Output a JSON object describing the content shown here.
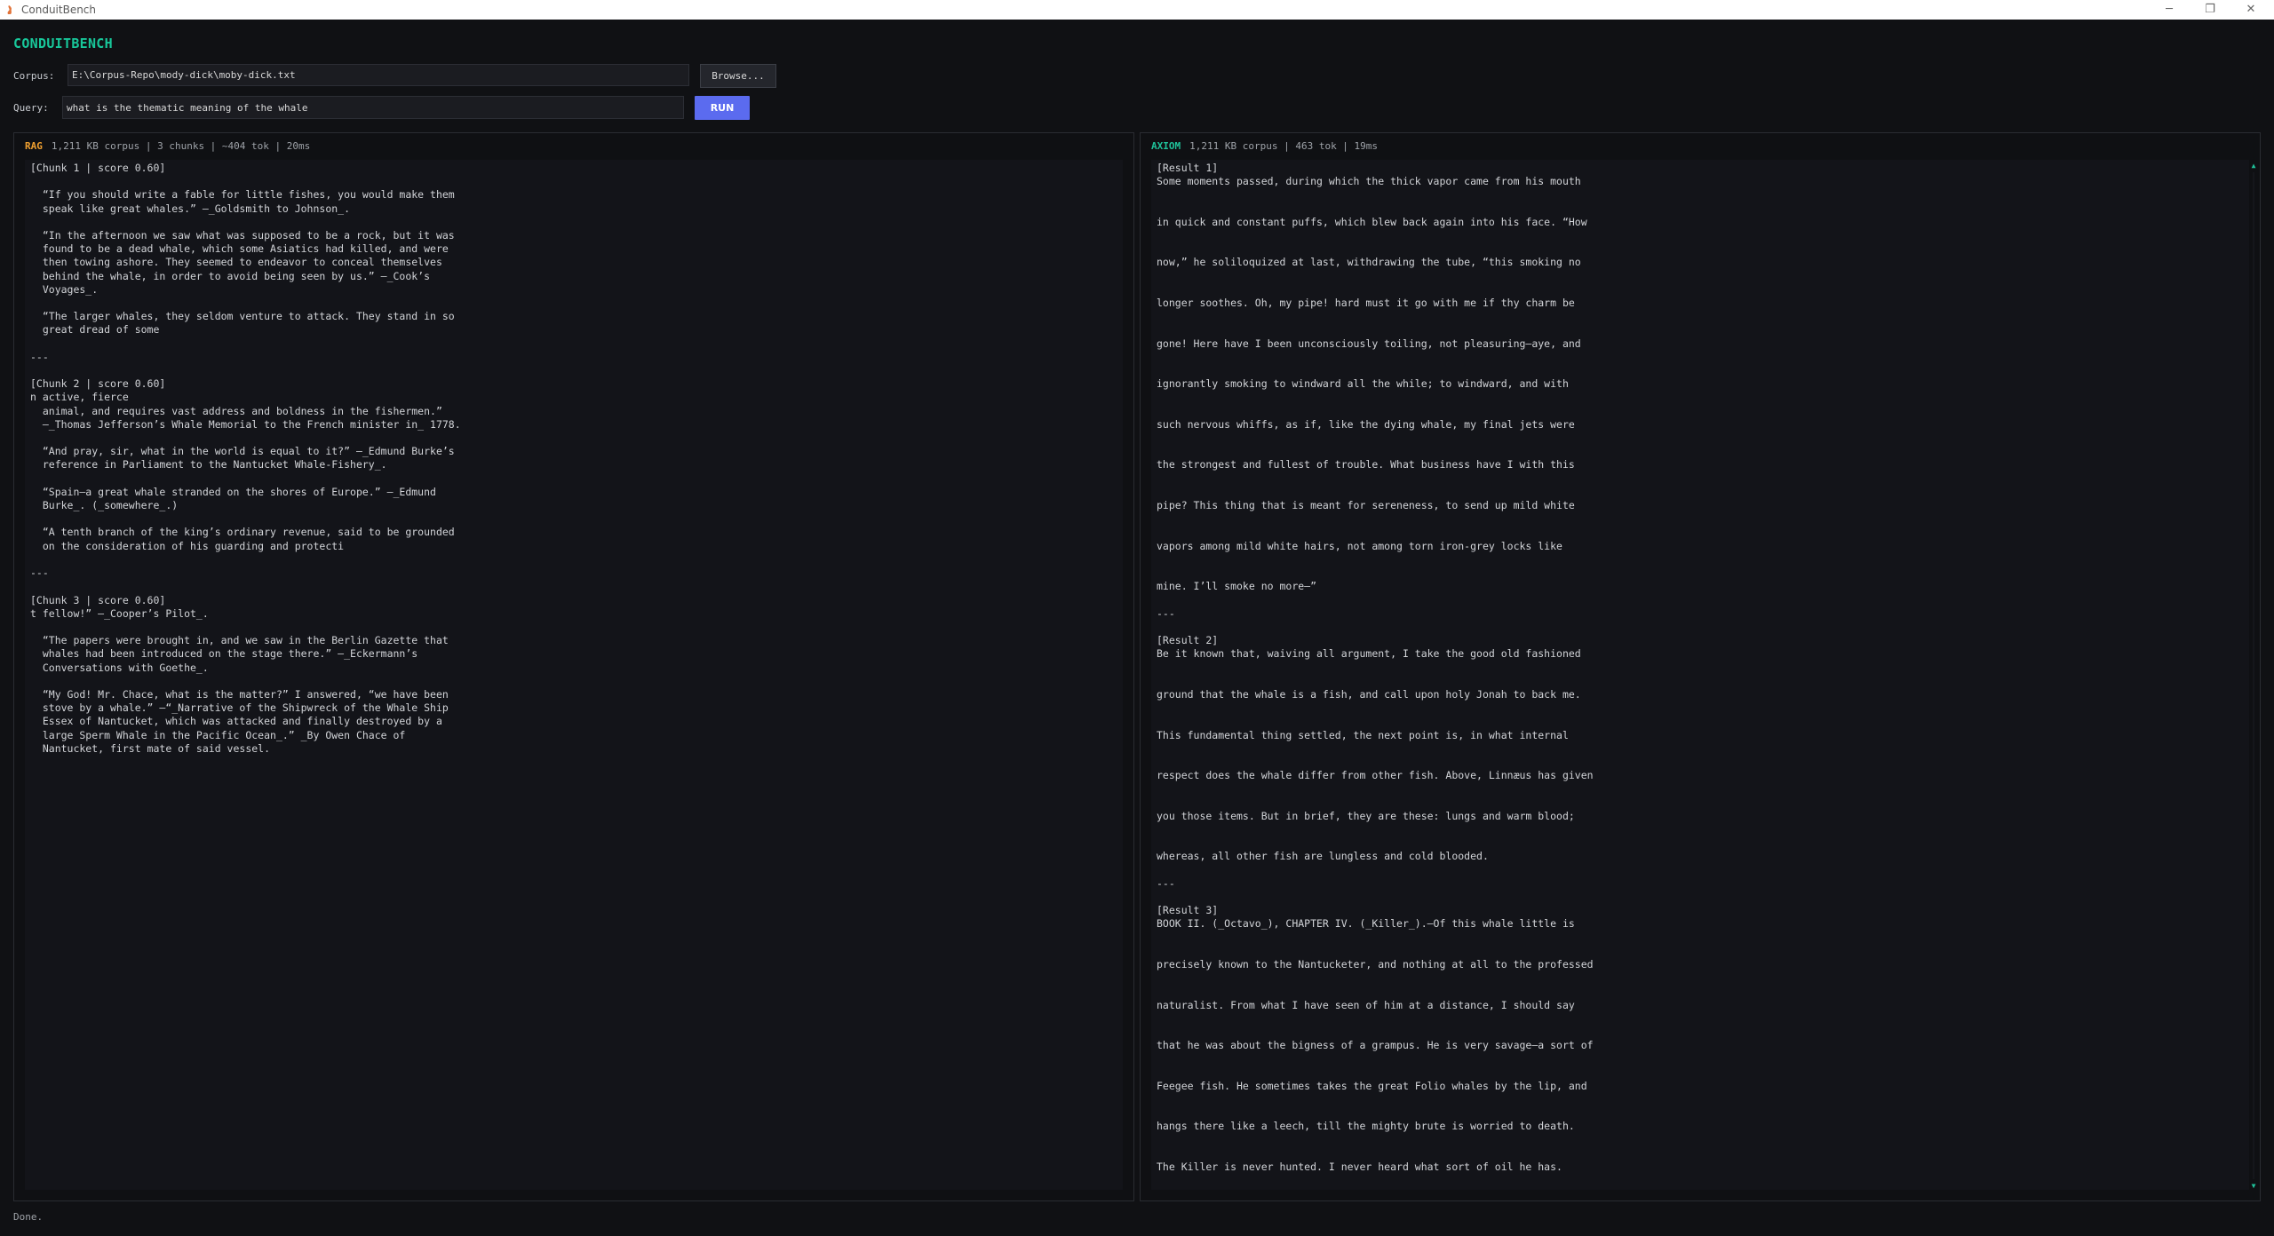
{
  "window": {
    "title": "ConduitBench",
    "minimize": "─",
    "restore": "❐",
    "close": "✕"
  },
  "app": {
    "title": "CONDUITBENCH"
  },
  "corpus": {
    "label": "Corpus:",
    "value": "E:\\Corpus-Repo\\mody-dick\\moby-dick.txt",
    "browse_label": "Browse..."
  },
  "query": {
    "label": "Query:",
    "value": "what is the thematic meaning of the whale",
    "run_label": "RUN"
  },
  "rag": {
    "tag": "RAG",
    "meta": "1,211 KB corpus | 3 chunks | ~404 tok | 20ms",
    "text": "[Chunk 1 | score 0.60]\n\n  “If you should write a fable for little fishes, you would make them\n  speak like great whales.” —_Goldsmith to Johnson_.\n\n  “In the afternoon we saw what was supposed to be a rock, but it was\n  found to be a dead whale, which some Asiatics had killed, and were\n  then towing ashore. They seemed to endeavor to conceal themselves\n  behind the whale, in order to avoid being seen by us.” —_Cook’s\n  Voyages_.\n\n  “The larger whales, they seldom venture to attack. They stand in so\n  great dread of some\n\n---\n\n[Chunk 2 | score 0.60]\nn active, fierce\n  animal, and requires vast address and boldness in the fishermen.”\n  —_Thomas Jefferson’s Whale Memorial to the French minister in_ 1778.\n\n  “And pray, sir, what in the world is equal to it?” —_Edmund Burke’s\n  reference in Parliament to the Nantucket Whale-Fishery_.\n\n  “Spain—a great whale stranded on the shores of Europe.” —_Edmund\n  Burke_. (_somewhere_.)\n\n  “A tenth branch of the king’s ordinary revenue, said to be grounded\n  on the consideration of his guarding and protecti\n\n---\n\n[Chunk 3 | score 0.60]\nt fellow!” —_Cooper’s Pilot_.\n\n  “The papers were brought in, and we saw in the Berlin Gazette that\n  whales had been introduced on the stage there.” —_Eckermann’s\n  Conversations with Goethe_.\n\n  “My God! Mr. Chace, what is the matter?” I answered, “we have been\n  stove by a whale.” —“_Narrative of the Shipwreck of the Whale Ship\n  Essex of Nantucket, which was attacked and finally destroyed by a\n  large Sperm Whale in the Pacific Ocean_.” _By Owen Chace of\n  Nantucket, first mate of said vessel."
  },
  "axiom": {
    "tag": "AXIOM",
    "meta": "1,211 KB corpus | 463 tok | 19ms",
    "text": "[Result 1]\nSome moments passed, during which the thick vapor came from his mouth\n\n\nin quick and constant puffs, which blew back again into his face. “How\n\n\nnow,” he soliloquized at last, withdrawing the tube, “this smoking no\n\n\nlonger soothes. Oh, my pipe! hard must it go with me if thy charm be\n\n\ngone! Here have I been unconsciously toiling, not pleasuring—aye, and\n\n\nignorantly smoking to windward all the while; to windward, and with\n\n\nsuch nervous whiffs, as if, like the dying whale, my final jets were\n\n\nthe strongest and fullest of trouble. What business have I with this\n\n\npipe? This thing that is meant for sereneness, to send up mild white\n\n\nvapors among mild white hairs, not among torn iron-grey locks like\n\n\nmine. I’ll smoke no more—”\n\n---\n\n[Result 2]\nBe it known that, waiving all argument, I take the good old fashioned\n\n\nground that the whale is a fish, and call upon holy Jonah to back me.\n\n\nThis fundamental thing settled, the next point is, in what internal\n\n\nrespect does the whale differ from other fish. Above, Linnæus has given\n\n\nyou those items. But in brief, they are these: lungs and warm blood;\n\n\nwhereas, all other fish are lungless and cold blooded.\n\n---\n\n[Result 3]\nBOOK II. (_Octavo_), CHAPTER IV. (_Killer_).—Of this whale little is\n\n\nprecisely known to the Nantucketer, and nothing at all to the professed\n\n\nnaturalist. From what I have seen of him at a distance, I should say\n\n\nthat he was about the bigness of a grampus. He is very savage—a sort of\n\n\nFeegee fish. He sometimes takes the great Folio whales by the lip, and\n\n\nhangs there like a leech, till the mighty brute is worried to death.\n\n\nThe Killer is never hunted. I never heard what sort of oil he has."
  },
  "scroll": {
    "up": "▲",
    "down": "▼"
  },
  "status": {
    "text": "Done."
  },
  "colors": {
    "accent": "#18c79a",
    "rag_tag": "#f0a030",
    "run_button": "#5b6bef"
  }
}
